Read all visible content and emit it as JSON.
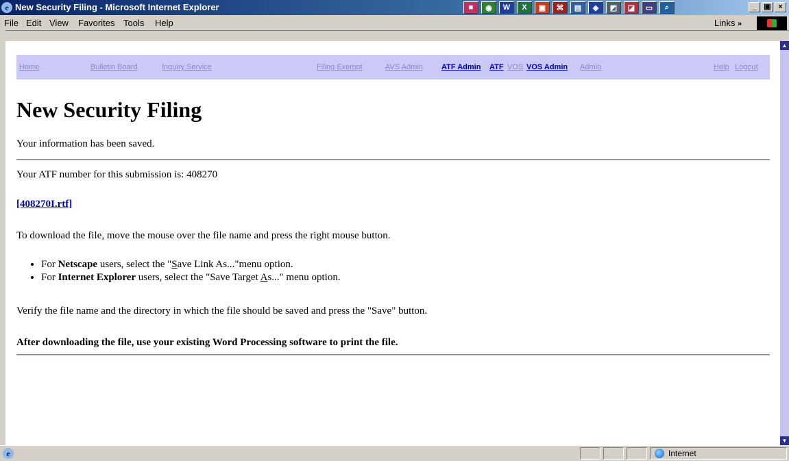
{
  "window": {
    "title": "New Security Filing - Microsoft Internet Explorer",
    "controls": [
      "_",
      "Б",
      "×"
    ]
  },
  "menu": [
    "File",
    "Edit",
    "View",
    "Favorites",
    "Tools",
    "Help"
  ],
  "links_label": "Links",
  "nav": {
    "home": "Home",
    "bulletin": "Bulletin Board",
    "inquiry": "Inquiry Service",
    "filing_exempt": "Filing Exempt",
    "avs_admin": "AVS Admin",
    "atf_admin": "ATF Admin",
    "atf": "ATF",
    "vos": "VOS",
    "vos_admin": "VOS Admin",
    "admin": "Admin",
    "help": "Help",
    "logout": "Logout"
  },
  "page": {
    "title": "New Security Filing",
    "saved_msg": "Your information has been saved.",
    "atf_prefix": "Your ATF number for this submission is: ",
    "atf_number": "408270",
    "file_link": "[408270I.rtf]",
    "download_instr": "To download the file, move the mouse over the file name and press the right mouse button.",
    "bullets": [
      {
        "pre": "For ",
        "bold": "Netscape",
        "mid": " users, select the \"",
        "ul": "S",
        "post": "ave Link As...\"menu option."
      },
      {
        "pre": "For ",
        "bold": "Internet Explorer",
        "mid": " users, select the \"Save Target ",
        "ul": "A",
        "post": "s...\" menu option."
      }
    ],
    "verify": "Verify the file name and the directory in which the file should be saved and press the \"Save\" button.",
    "final": "After downloading the file, use your existing Word Processing software to print the file."
  },
  "status": {
    "zone": "Internet"
  }
}
